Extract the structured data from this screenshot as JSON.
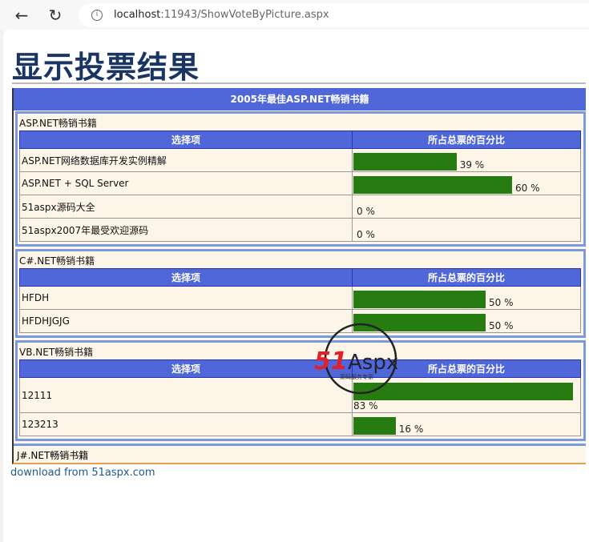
{
  "browser": {
    "url_host": "localhost",
    "url_rest": ":11943/ShowVoteByPicture.aspx"
  },
  "page_title": "显示投票结果",
  "survey_title": "2005年最佳ASP.NET畅销书籍",
  "col_item": "选择项",
  "col_percent": "所占总票的百分比",
  "groups": [
    {
      "label": "ASP.NET畅销书籍",
      "rows": [
        {
          "item": "ASP.NET网络数据库开发实例精解",
          "percent": 39
        },
        {
          "item": "ASP.NET + SQL Server",
          "percent": 60
        },
        {
          "item": "51aspx源码大全",
          "percent": 0
        },
        {
          "item": "51aspx2007年最受欢迎源码",
          "percent": 0
        }
      ]
    },
    {
      "label": "C#.NET畅销书籍",
      "rows": [
        {
          "item": "HFDH",
          "percent": 50
        },
        {
          "item": "HFDHJGJG",
          "percent": 50
        }
      ]
    },
    {
      "label": "VB.NET畅销书籍",
      "rows": [
        {
          "item": "12111",
          "percent": 83
        },
        {
          "item": "123213",
          "percent": 16
        }
      ]
    }
  ],
  "empty_group": "J#.NET畅销书籍",
  "footer_link": "download from 51aspx.com",
  "watermark": {
    "brand": "51Aspx",
    "tagline": "源码服务专家"
  },
  "colors": {
    "header": "#4f67d8",
    "bar": "#267c10",
    "bg": "#fdf5e8"
  }
}
